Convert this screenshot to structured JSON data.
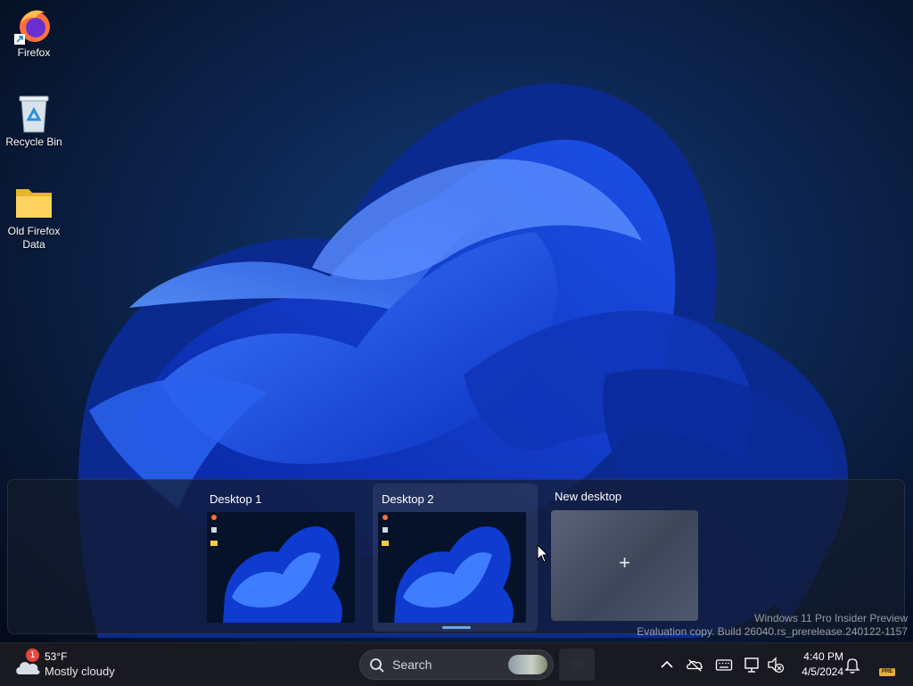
{
  "desktop": {
    "icons": [
      {
        "name": "Firefox"
      },
      {
        "name": "Recycle Bin"
      },
      {
        "name": "Old Firefox Data"
      }
    ]
  },
  "task_view": {
    "desktops": [
      {
        "label": "Desktop 1"
      },
      {
        "label": "Desktop 2"
      }
    ],
    "new_desktop_label": "New desktop",
    "new_desktop_symbol": "+"
  },
  "watermark": {
    "line1": "Windows 11 Pro Insider Preview",
    "line2": "Evaluation copy. Build 26040.rs_prerelease.240122-1157"
  },
  "taskbar": {
    "weather": {
      "temperature": "53°F",
      "condition": "Mostly cloudy",
      "badge": "1"
    },
    "search_placeholder": "Search",
    "clock": {
      "time": "4:40 PM",
      "date": "4/5/2024"
    },
    "pre_badge": "PRE",
    "tray_icons": [
      "chevron-up-icon",
      "onedrive-offline-icon",
      "keyboard-icon",
      "network-icon",
      "volume-muted-icon",
      "notification-bell-icon"
    ]
  },
  "colors": {
    "accent": "#6ea8e6",
    "taskbar": "#1a1b21"
  }
}
